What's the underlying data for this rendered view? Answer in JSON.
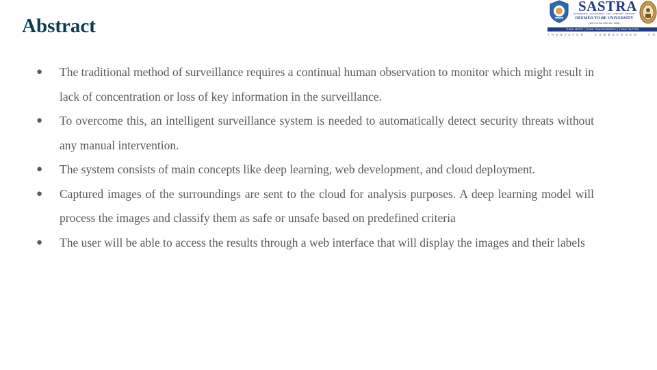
{
  "slide": {
    "title": "Abstract",
    "bullets": [
      "The traditional method of surveillance requires a continual human observation to monitor which might result in lack of concentration or loss of key information in the surveillance.",
      "To overcome this, an intelligent surveillance system is needed to automatically detect security threats without any manual intervention.",
      "The system consists of main concepts like deep learning, web development, and cloud deployment.",
      "Captured images of the surroundings are sent to the cloud for analysis purposes. A deep learning model will process the images and classify them as safe or unsafe based on predefined criteria",
      "The user will be able to access the results through a web interface that will display the images and their labels"
    ],
    "bullet_marker": "●"
  },
  "logo": {
    "name": "SASTRA",
    "tagline": "ENGINEERING · MANAGEMENT · LAW · SCIENCES · HUMANITIES · EDUCATION",
    "deemed": "DEEMED TO BE UNIVERSITY",
    "ugc": "(U/S 3 of the UGC Act, 1956)",
    "motto": "THINK MERIT | THINK TRANSPARENCY | THINK SASTRA",
    "cities": "THANJAVUR · KUMBAKONAM · CHENNAI",
    "brand_color": "#1e3a8a",
    "crest_icon": "university-crest-icon",
    "seal_icon": "university-seal-icon"
  },
  "colors": {
    "title": "#0b3b4c",
    "body_text": "#595959",
    "background": "#ffffff"
  }
}
